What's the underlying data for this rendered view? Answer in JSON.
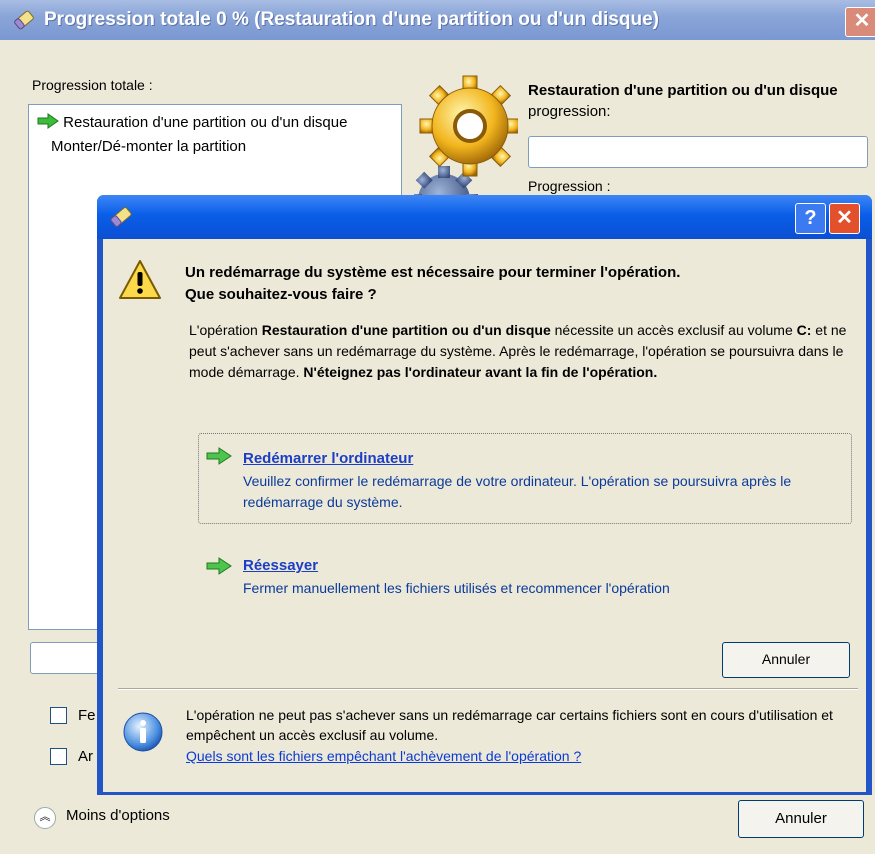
{
  "background_window": {
    "title": "Progression totale 0 % (Restauration d'une partition ou d'un disque)",
    "close_label": "✕",
    "total_progress_label": "Progression totale :",
    "tasks": [
      {
        "label": "Restauration d'une partition ou d'un disque",
        "current": true
      },
      {
        "label": "Monter/Dé-monter la partition",
        "current": false
      }
    ],
    "operation_title_bold": "Restauration d'une partition ou d'un disque",
    "operation_title_suffix": " progression:",
    "progression_label": "Progression :",
    "checkbox1_label": "Fe",
    "checkbox2_label": "Ar",
    "less_options_label": "Moins d'options",
    "cancel_label": "Annuler"
  },
  "dialog": {
    "help_label": "?",
    "close_label": "✕",
    "heading_line1": "Un redémarrage du système est nécessaire pour terminer l'opération.",
    "heading_line2": "Que souhaitez-vous faire ?",
    "desc": {
      "p1": "L'opération ",
      "b1": "Restauration d'une partition ou d'un disque",
      "p2": " nécessite un accès exclusif au volume ",
      "b2": "C:",
      "p3": " et ne peut s'achever sans un redémarrage du système. Après le redémarrage, l'opération se poursuivra dans le mode démarrage. ",
      "b3": "N'éteignez pas l'ordinateur avant la fin de l'opération."
    },
    "options": [
      {
        "title": "Redémarrer l'ordinateur",
        "description": "Veuillez confirmer le redémarrage de votre ordinateur. L'opération se poursuivra après le redémarrage du système."
      },
      {
        "title": "Réessayer",
        "description": "Fermer manuellement les fichiers utilisés et recommencer l'opération"
      }
    ],
    "cancel_label": "Annuler",
    "info_text": "L'opération ne peut pas s'achever sans un redémarrage car certains fichiers sont en cours d'utilisation et empêchent un accès exclusif au volume.",
    "info_link": "Quels sont les fichiers empêchant l'achèvement de l'opération ?"
  },
  "icons": {
    "title": "eraser-icon",
    "gear": "gear-icon",
    "warning": "warning-icon",
    "arrow": "green-arrow-icon",
    "info": "info-icon",
    "collapse": "chevron-up-icon"
  },
  "colors": {
    "window_bg": "#ece9d8",
    "dialog_title": "#0b5ee8",
    "link": "#1c3ec6",
    "arrow": "#3dbb3d"
  }
}
